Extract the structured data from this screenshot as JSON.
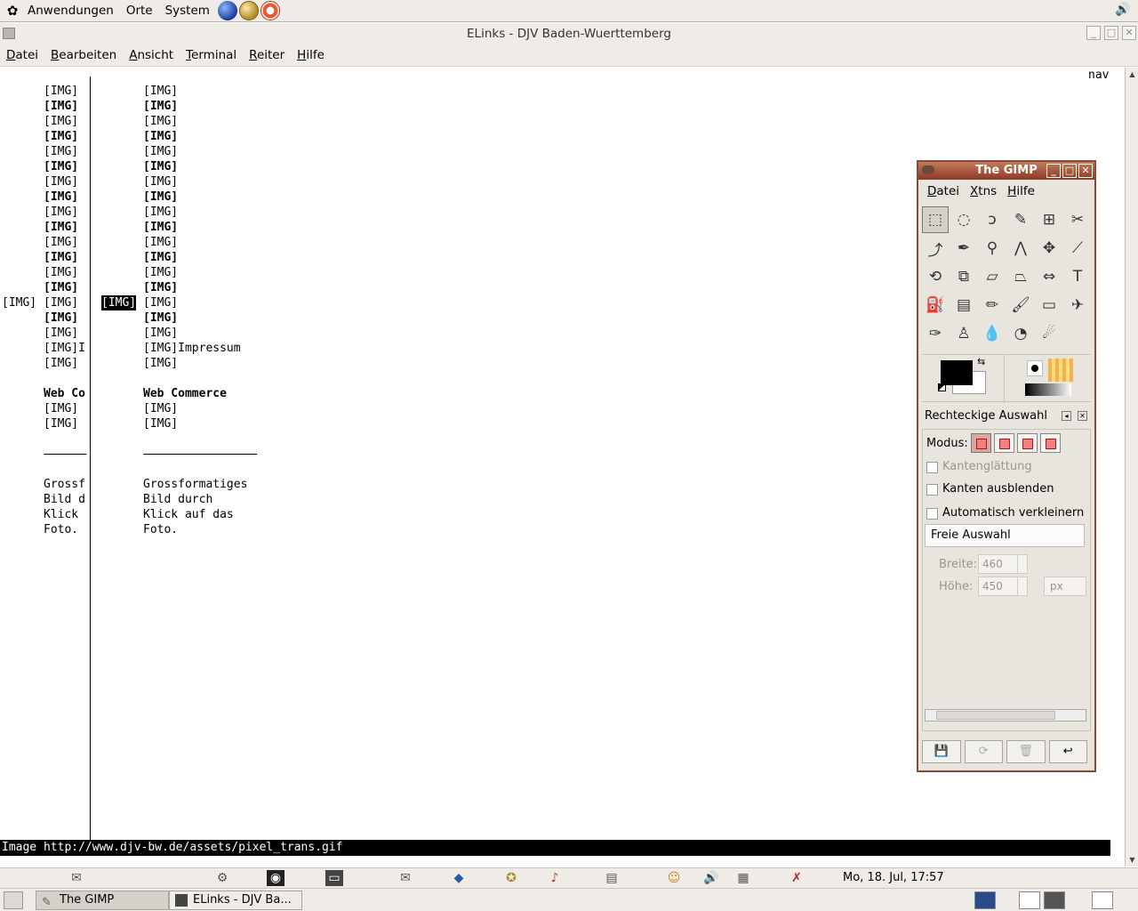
{
  "top_panel": {
    "menus": [
      "Anwendungen",
      "Orte",
      "System"
    ],
    "icons": [
      "gnome-foot-icon",
      "web-browser-icon",
      "mail-icon",
      "help-icon",
      "volume-icon"
    ]
  },
  "terminal": {
    "title": "ELinks - DJV Baden-Wuerttemberg",
    "menu": [
      "Datei",
      "Bearbeiten",
      "Ansicht",
      "Terminal",
      "Reiter",
      "Hilfe"
    ],
    "nav_label": "nav",
    "left_col_rows": [
      {
        "text": "[IMG]",
        "bold": false
      },
      {
        "text": "[IMG]",
        "bold": true
      },
      {
        "text": "[IMG]",
        "bold": false
      },
      {
        "text": "[IMG]",
        "bold": true
      },
      {
        "text": "[IMG]",
        "bold": false
      },
      {
        "text": "[IMG]",
        "bold": true
      },
      {
        "text": "[IMG]",
        "bold": false
      },
      {
        "text": "[IMG]",
        "bold": true
      },
      {
        "text": "[IMG]",
        "bold": false
      },
      {
        "text": "[IMG]",
        "bold": true
      },
      {
        "text": "[IMG]",
        "bold": false
      },
      {
        "text": "[IMG]",
        "bold": true
      },
      {
        "text": "[IMG]",
        "bold": false
      },
      {
        "text": "[IMG]",
        "bold": true
      },
      {
        "text": "[IMG]",
        "bold": false
      },
      {
        "text": "[IMG]",
        "bold": true
      },
      {
        "text": "[IMG]",
        "bold": false
      },
      {
        "text": "[IMG]I",
        "bold": false
      },
      {
        "text": "[IMG]",
        "bold": false
      }
    ],
    "right_col_rows": [
      {
        "text": "[IMG]",
        "bold": false
      },
      {
        "text": "[IMG]",
        "bold": true
      },
      {
        "text": "[IMG]",
        "bold": false
      },
      {
        "text": "[IMG]",
        "bold": true
      },
      {
        "text": "[IMG]",
        "bold": false
      },
      {
        "text": "[IMG]",
        "bold": true
      },
      {
        "text": "[IMG]",
        "bold": false
      },
      {
        "text": "[IMG]",
        "bold": true
      },
      {
        "text": "[IMG]",
        "bold": false
      },
      {
        "text": "[IMG]",
        "bold": true
      },
      {
        "text": "[IMG]",
        "bold": false
      },
      {
        "text": "[IMG]",
        "bold": true
      },
      {
        "text": "[IMG]",
        "bold": false
      },
      {
        "text": "[IMG]",
        "bold": true
      },
      {
        "text": "[IMG]",
        "bold": false
      },
      {
        "text": "[IMG]",
        "bold": true
      },
      {
        "text": "[IMG]",
        "bold": false
      },
      {
        "text": "[IMG]Impressum",
        "bold": false
      },
      {
        "text": "[IMG]",
        "bold": false
      }
    ],
    "far_left_img": "[IMG]",
    "highlighted_img": "[IMG]",
    "left_web": "Web Co",
    "right_web": "Web Commerce",
    "left_after_web": [
      "[IMG]",
      "[IMG]"
    ],
    "right_after_web": [
      "[IMG]",
      "[IMG]"
    ],
    "left_text": [
      "Grossf",
      "Bild d",
      "Klick",
      "Foto."
    ],
    "right_text": [
      "Grossformatiges",
      "Bild durch",
      "Klick auf das",
      "Foto."
    ],
    "status": "Image http://www.djv-bw.de/assets/pixel_trans.gif"
  },
  "gimp": {
    "title": "The GIMP",
    "menu": [
      "Datei",
      "Xtns",
      "Hilfe"
    ],
    "tools": [
      "rect-select-icon",
      "ellipse-select-icon",
      "lasso-icon",
      "fuzzy-select-icon",
      "color-select-icon",
      "scissors-icon",
      "paths-icon",
      "color-picker-icon",
      "zoom-icon",
      "measure-icon",
      "move-icon",
      "crop-icon",
      "rotate-icon",
      "scale-icon",
      "shear-icon",
      "perspective-icon",
      "flip-icon",
      "text-icon",
      "bucket-fill-icon",
      "blend-icon",
      "pencil-icon",
      "paintbrush-icon",
      "eraser-icon",
      "airbrush-icon",
      "ink-icon",
      "clone-icon",
      "blur-icon",
      "dodge-burn-icon",
      "smudge-icon"
    ],
    "tool_glyphs": [
      "⬚",
      "◌",
      "ↄ",
      "✎",
      "⊞",
      "✂",
      "⤴",
      "✒",
      "⚲",
      "⋀",
      "✥",
      "⟋",
      "⟲",
      "⧉",
      "▱",
      "⏢",
      "⇔",
      "T",
      "⛽",
      "▤",
      "✏",
      "🖌",
      "▭",
      "✈",
      "✑",
      "♙",
      "💧",
      "◔",
      "☄"
    ],
    "tool_options_title": "Rechteckige Auswahl",
    "mode_label": "Modus:",
    "antialias_label": "Kantenglättung",
    "feather_label": "Kanten ausblenden",
    "autoshrink_label": "Automatisch verkleinern",
    "freie_label": "Freie Auswahl",
    "breite_label": "Breite:",
    "breite_value": "460",
    "hoehe_label": "Höhe:",
    "hoehe_value": "450",
    "unit_value": "px"
  },
  "bottom_panel": {
    "clock": "Mo, 18. Jul, 17:57",
    "tasks": [
      "The GIMP",
      "ELinks - DJV Ba..."
    ]
  }
}
